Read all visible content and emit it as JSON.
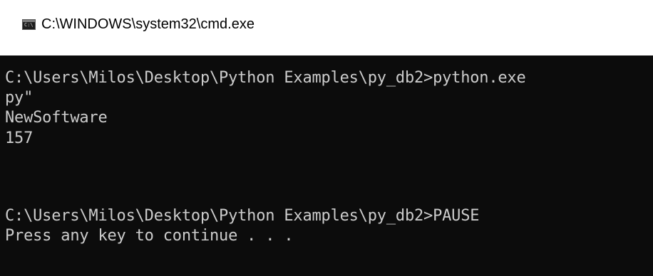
{
  "window": {
    "title": "C:\\WINDOWS\\system32\\cmd.exe",
    "icon": "cmd-console-icon",
    "icon_glyph": "C:\\"
  },
  "console": {
    "background": "#0c0c0c",
    "text_color": "#cccccc",
    "lines": [
      "C:\\Users\\Milos\\Desktop\\Python Examples\\py_db2>python.exe",
      "py\"",
      "NewSoftware",
      "157",
      "C:\\Users\\Milos\\Desktop\\Python Examples\\py_db2>PAUSE",
      "Press any key to continue . . ."
    ]
  }
}
